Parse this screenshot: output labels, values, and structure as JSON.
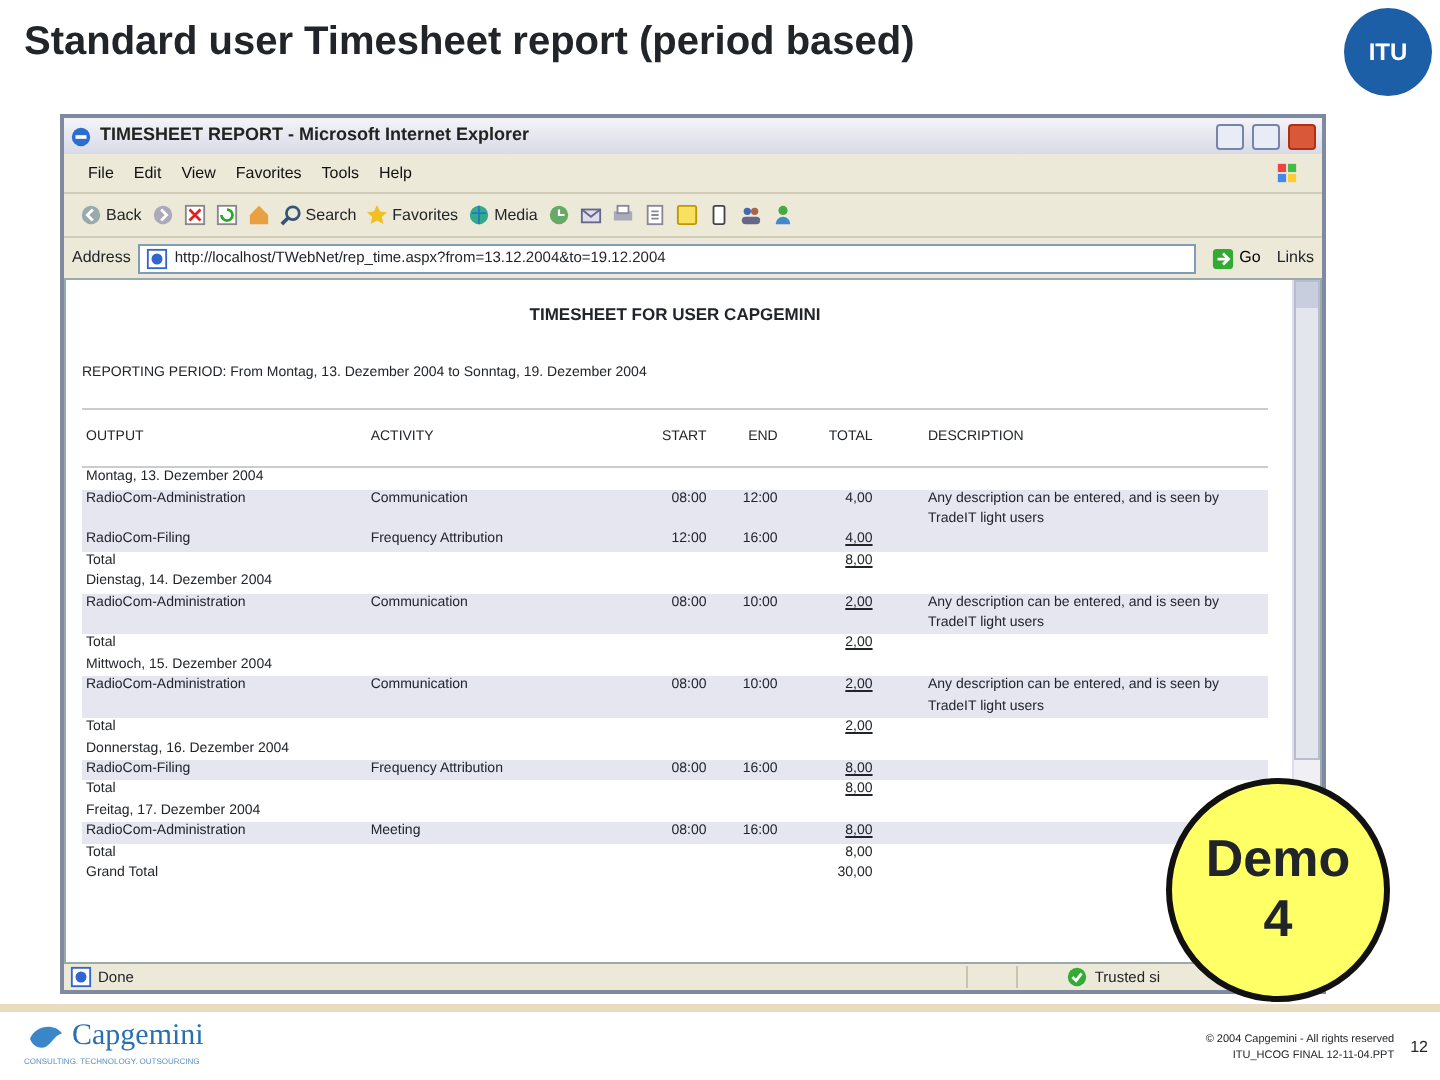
{
  "slide": {
    "title": "Standard user Timesheet report (period based)",
    "logo_text": "ITU"
  },
  "browser": {
    "title": "TIMESHEET REPORT - Microsoft Internet Explorer",
    "menu": [
      "File",
      "Edit",
      "View",
      "Favorites",
      "Tools",
      "Help"
    ],
    "toolbar": [
      {
        "kind": "back",
        "label": "Back"
      },
      {
        "kind": "forward"
      },
      {
        "kind": "stop"
      },
      {
        "kind": "refresh"
      },
      {
        "kind": "home"
      },
      {
        "kind": "search",
        "label": "Search"
      },
      {
        "kind": "favorites",
        "label": "Favorites"
      },
      {
        "kind": "media",
        "label": "Media"
      },
      {
        "kind": "history"
      },
      {
        "kind": "mail"
      },
      {
        "kind": "print"
      },
      {
        "kind": "edit"
      },
      {
        "kind": "note"
      },
      {
        "kind": "phone"
      },
      {
        "kind": "people"
      },
      {
        "kind": "messenger"
      }
    ],
    "address": {
      "label": "Address",
      "url": "http://localhost/TWebNet/rep_time.aspx?from=13.12.2004&to=19.12.2004"
    },
    "go": "Go",
    "links": "Links",
    "report": {
      "heading": "TIMESHEET FOR USER CAPGEMINI",
      "period": "REPORTING PERIOD: From Montag, 13. Dezember 2004 to Sonntag, 19. Dezember 2004",
      "columns": [
        "OUTPUT",
        "ACTIVITY",
        "START",
        "END",
        "TOTAL",
        "DESCRIPTION"
      ],
      "groups": [
        {
          "date": "Montag, 13. Dezember 2004",
          "entries": [
            {
              "output": "RadioCom-Administration",
              "activity": "Communication",
              "start": "08:00",
              "end": "12:00",
              "total": "4,00",
              "total_linked": false,
              "description": "Any description can be entered, and is seen by TradeIT light users"
            },
            {
              "output": "RadioCom-Filing",
              "activity": "Frequency Attribution",
              "start": "12:00",
              "end": "16:00",
              "total": "4,00",
              "total_linked": true
            }
          ],
          "total_label": "Total",
          "total": "8,00",
          "total_linked": true
        },
        {
          "date": "Dienstag, 14. Dezember 2004",
          "entries": [
            {
              "output": "RadioCom-Administration",
              "activity": "Communication",
              "start": "08:00",
              "end": "10:00",
              "total": "2,00",
              "total_linked": true,
              "description": "Any description can be entered, and is seen by TradeIT light users"
            }
          ],
          "total_label": "Total",
          "total": "2,00",
          "total_linked": true
        },
        {
          "date": "Mittwoch, 15. Dezember 2004",
          "entries": [
            {
              "output": "RadioCom-Administration",
              "activity": "Communication",
              "start": "08:00",
              "end": "10:00",
              "total": "2,00",
              "total_linked": true,
              "description": "Any description can be entered, and is seen by TradeIT light users"
            }
          ],
          "total_label": "Total",
          "total": "2,00",
          "total_linked": true
        },
        {
          "date": "Donnerstag, 16. Dezember 2004",
          "entries": [
            {
              "output": "RadioCom-Filing",
              "activity": "Frequency Attribution",
              "start": "08:00",
              "end": "16:00",
              "total": "8,00",
              "total_linked": true
            }
          ],
          "total_label": "Total",
          "total": "8,00",
          "total_linked": true
        },
        {
          "date": "Freitag, 17. Dezember 2004",
          "entries": [
            {
              "output": "RadioCom-Administration",
              "activity": "Meeting",
              "start": "08:00",
              "end": "16:00",
              "total": "8,00",
              "total_linked": true
            }
          ],
          "total_label": "Total",
          "total": "8,00",
          "total_linked": false
        }
      ],
      "grand_total_label": "Grand Total",
      "grand_total": "30,00"
    },
    "status": {
      "text": "Done",
      "zone": "Trusted si"
    }
  },
  "badge": {
    "lines": [
      "Demo",
      "4"
    ]
  },
  "footer": {
    "logo": "Capgemini",
    "tagline": "CONSULTING. TECHNOLOGY. OUTSOURCING",
    "copyright": "© 2004 Capgemini - All rights reserved",
    "file": "ITU_HCOG FINAL 12-11-04.PPT",
    "page": "12"
  }
}
